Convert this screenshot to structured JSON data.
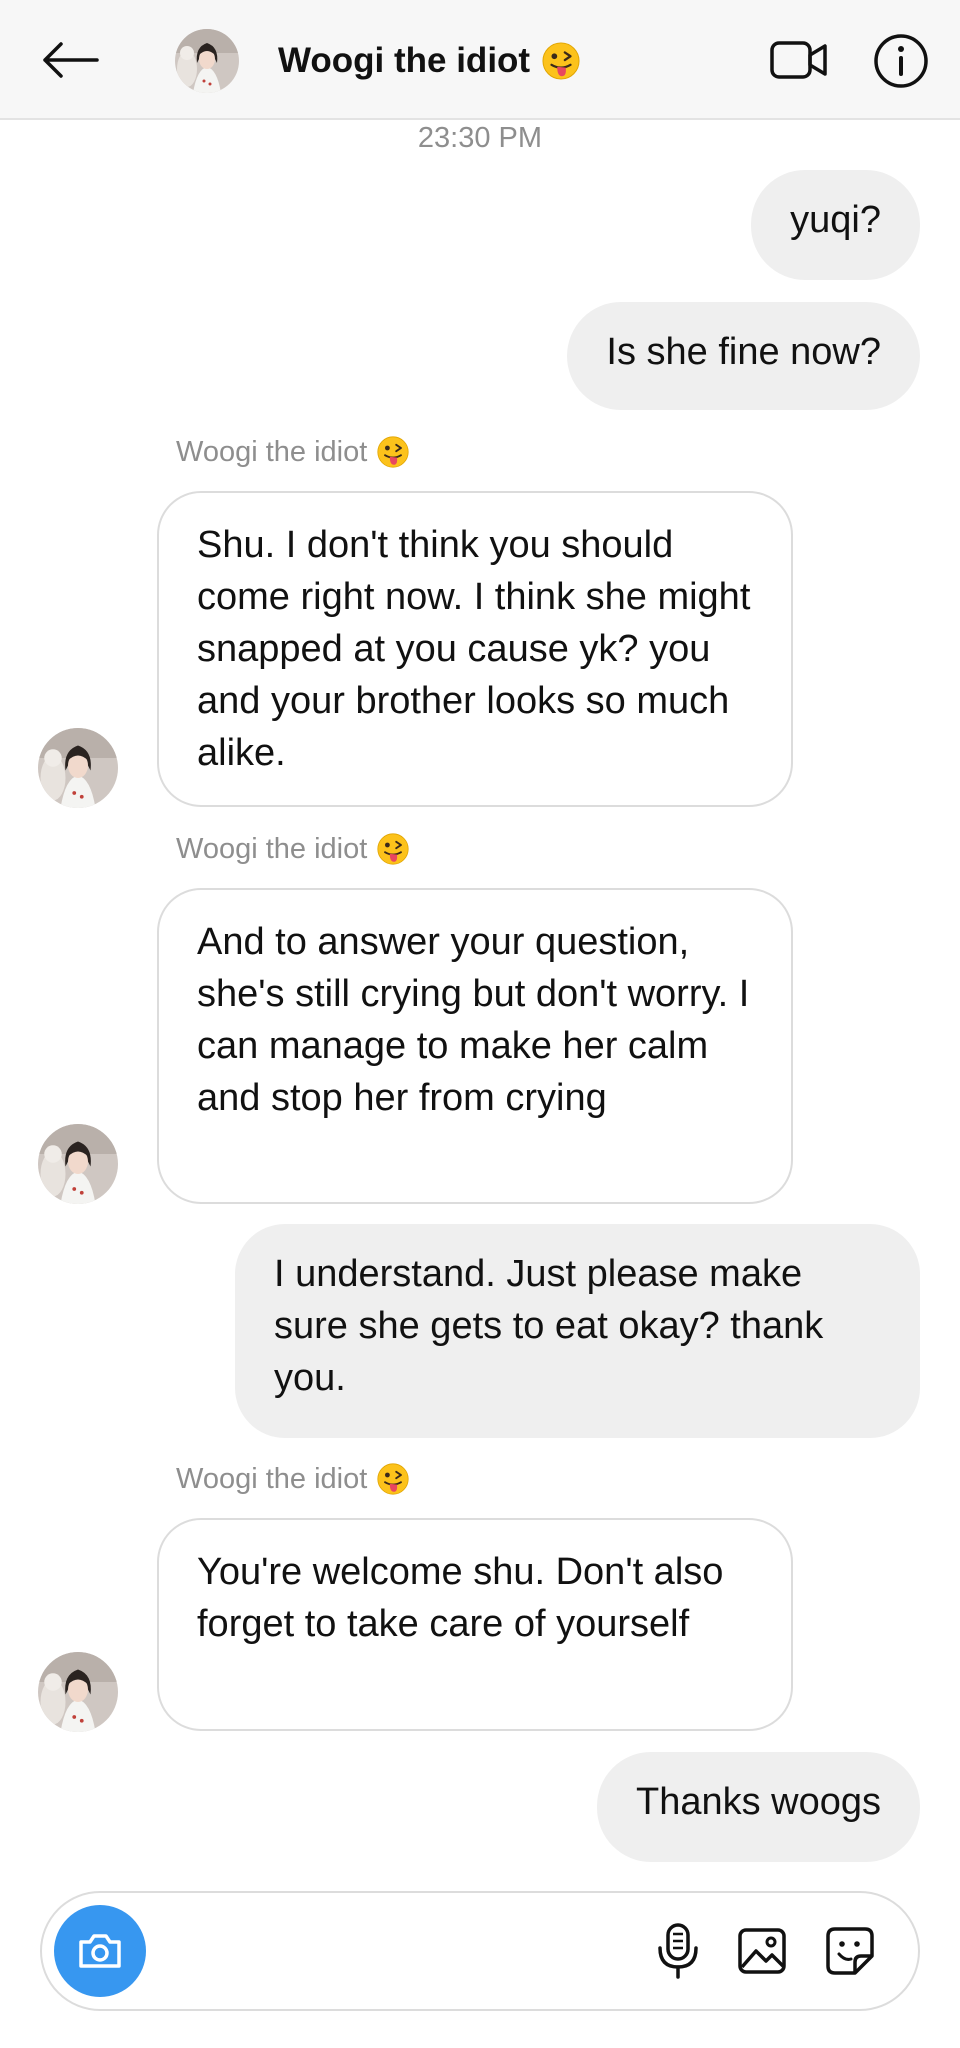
{
  "header": {
    "title": "Woogi the idiot",
    "title_emoji": "😜",
    "icons": {
      "back": "back-arrow-icon",
      "video": "video-call-icon",
      "info": "info-icon"
    }
  },
  "thread": {
    "timestamp": "23:30 PM",
    "sender_name": "Woogi the idiot",
    "messages": [
      {
        "from": "me",
        "text": "yuqi?"
      },
      {
        "from": "me",
        "text": "Is she fine now?"
      },
      {
        "from": "them",
        "text": "Shu. I don't think you should come right now. I think she might snapped at you cause yk? you and your brother looks so much alike."
      },
      {
        "from": "them",
        "text": "And to answer your question, she's still crying but don't worry. I can manage to make her calm and stop her from crying"
      },
      {
        "from": "me",
        "text": "I understand. Just please make sure she gets to eat okay? thank you."
      },
      {
        "from": "them",
        "text": "You're welcome shu. Don't also forget to take care of yourself"
      },
      {
        "from": "me",
        "text": "Thanks woogs"
      }
    ]
  },
  "composer": {
    "placeholder": "",
    "icons": {
      "camera": "camera-icon",
      "mic": "microphone-icon",
      "gallery": "gallery-icon",
      "sticker": "sticker-icon"
    }
  },
  "colors": {
    "header_bg": "#f7f7f7",
    "outgoing_bubble": "#efefef",
    "incoming_border": "#dcdcdc",
    "camera_button": "#3797f0",
    "muted_text": "#8e8e8e"
  }
}
